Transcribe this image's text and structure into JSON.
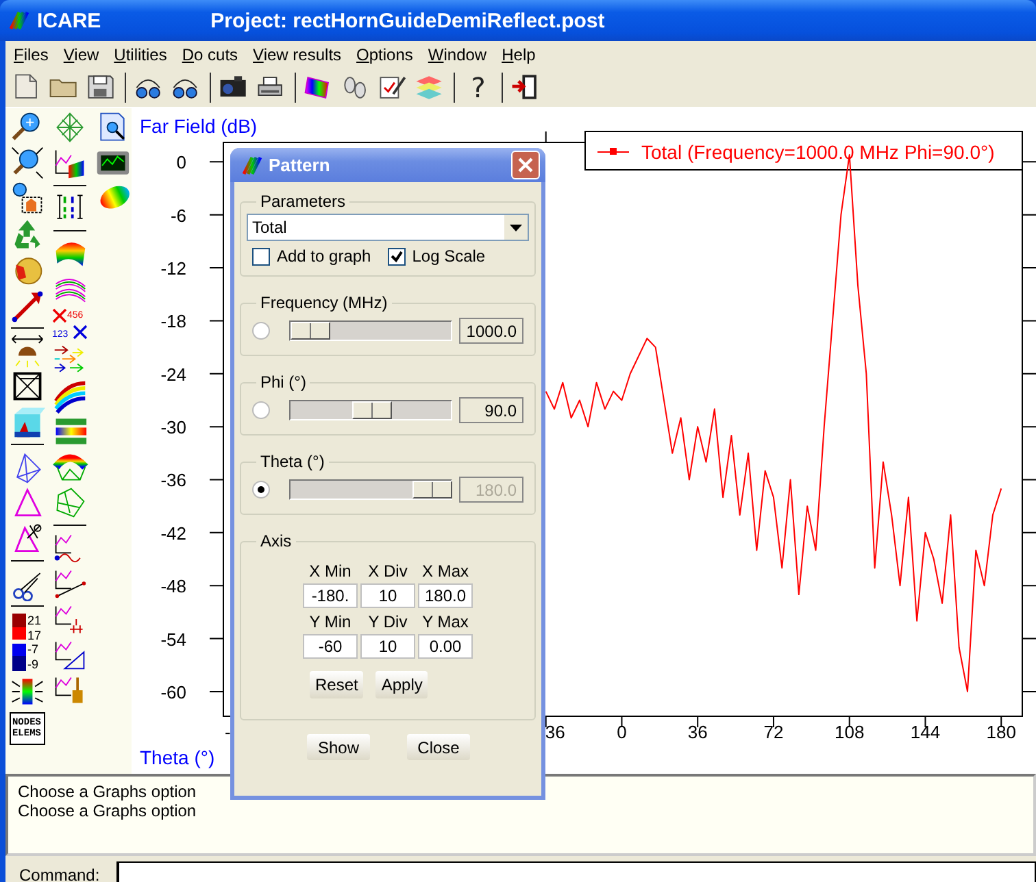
{
  "window": {
    "title": "ICARE",
    "project_title": "Project: rectHornGuideDemiReflect.post"
  },
  "menu": [
    {
      "label": "Files"
    },
    {
      "label": "View"
    },
    {
      "label": "Utilities"
    },
    {
      "label": "Do cuts"
    },
    {
      "label": "View results"
    },
    {
      "label": "Options"
    },
    {
      "label": "Window"
    },
    {
      "label": "Help"
    }
  ],
  "toolbar": {
    "help_symbol": "?"
  },
  "palette": {
    "scale_values": [
      "21",
      "17",
      "-7",
      "-9"
    ],
    "cross_numbers": [
      "456",
      "123"
    ],
    "document_labels": [
      "NODES",
      "ELEMS"
    ]
  },
  "chart": {
    "chart_data": {
      "type": "line",
      "xlabel": "Theta (°)",
      "ylabel": "Far Field (dB)",
      "x": [
        -36,
        -32,
        -28,
        -24,
        -20,
        -16,
        -12,
        -8,
        -4,
        0,
        4,
        8,
        12,
        16,
        20,
        24,
        28,
        32,
        36,
        40,
        44,
        48,
        52,
        56,
        60,
        64,
        68,
        72,
        76,
        80,
        84,
        88,
        92,
        96,
        100,
        104,
        108,
        112,
        116,
        120,
        124,
        128,
        132,
        136,
        140,
        144,
        148,
        152,
        156,
        160,
        164,
        168,
        172,
        176,
        180
      ],
      "series": [
        {
          "name": "Total (Frequency=1000.0 MHz Phi=90.0°)",
          "color": "#ff0000",
          "values": [
            -26,
            -28,
            -25,
            -29,
            -27,
            -30,
            -25,
            -28,
            -26,
            -27,
            -24,
            -22,
            -20,
            -21,
            -27,
            -33,
            -29,
            -36,
            -30,
            -34,
            -28,
            -38,
            -31,
            -40,
            -33,
            -44,
            -35,
            -38,
            -46,
            -36,
            -49,
            -39,
            -44,
            -30,
            -18,
            -6,
            0.8,
            -14,
            -24,
            -46,
            -34,
            -40,
            -48,
            -38,
            -52,
            -42,
            -45,
            -50,
            -40,
            -55,
            -60,
            -44,
            -48,
            -40,
            -37
          ]
        }
      ],
      "xlim": [
        -189,
        190
      ],
      "ylim": [
        -62.8,
        2.2
      ],
      "xticks": [
        {
          "value": -36,
          "label": "36"
        },
        0,
        36,
        72,
        108,
        144,
        180
      ],
      "yticks": [
        0,
        -6,
        -12,
        -18,
        -24,
        -30,
        -36,
        -42,
        -48,
        -54,
        -60
      ]
    },
    "covered_label_fragment": "-"
  },
  "dialog": {
    "title": "Pattern",
    "parameters": {
      "legend": "Parameters",
      "quantity": "Total",
      "options": [
        {
          "label": "Add to graph",
          "checked": false
        },
        {
          "label": "Log Scale",
          "checked": true
        }
      ]
    },
    "sliders": [
      {
        "legend": "Frequency (MHz)",
        "selected": false,
        "level": 0.0,
        "reading": "1000.0",
        "disabled": false
      },
      {
        "legend": "Phi (°)",
        "selected": false,
        "level": 0.5,
        "reading": "90.0",
        "disabled": false
      },
      {
        "legend": "Theta (°)",
        "selected": true,
        "level": 1.0,
        "reading": "180.0",
        "disabled": true
      }
    ],
    "axis": {
      "legend": "Axis",
      "fields": [
        {
          "label": "X Min",
          "value": "-180."
        },
        {
          "label": "X Div",
          "value": "10"
        },
        {
          "label": "X Max",
          "value": "180.0"
        },
        {
          "label": "Y Min",
          "value": "-60"
        },
        {
          "label": "Y Div",
          "value": "10"
        },
        {
          "label": "Y Max",
          "value": "0.00"
        }
      ],
      "buttons": [
        "Reset",
        "Apply"
      ]
    },
    "buttons": [
      "Show",
      "Close"
    ]
  },
  "messages": [
    "Choose a Graphs option",
    "Choose a Graphs option"
  ],
  "command": {
    "label": "Command:"
  }
}
